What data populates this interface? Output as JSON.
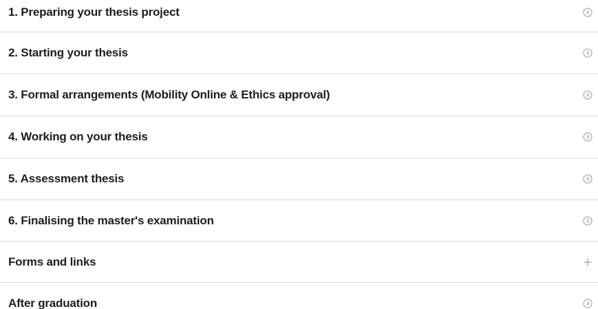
{
  "accordion": {
    "items": [
      {
        "label": "1. Preparing your thesis project",
        "icon": "chevron-circle-right-icon"
      },
      {
        "label": "2. Starting your thesis",
        "icon": "chevron-circle-right-icon"
      },
      {
        "label": "3. Formal arrangements (Mobility Online & Ethics approval)",
        "icon": "chevron-circle-right-icon"
      },
      {
        "label": "4. Working on your thesis",
        "icon": "chevron-circle-right-icon"
      },
      {
        "label": "5. Assessment thesis",
        "icon": "chevron-circle-right-icon"
      },
      {
        "label": "6. Finalising the master's examination",
        "icon": "chevron-circle-right-icon"
      },
      {
        "label": "Forms and links",
        "icon": "plus-icon"
      },
      {
        "label": "After graduation",
        "icon": "chevron-circle-right-icon"
      }
    ]
  },
  "colors": {
    "text": "#1e1e1e",
    "icon": "#9a9a9a",
    "divider": "#d8d8d8"
  }
}
